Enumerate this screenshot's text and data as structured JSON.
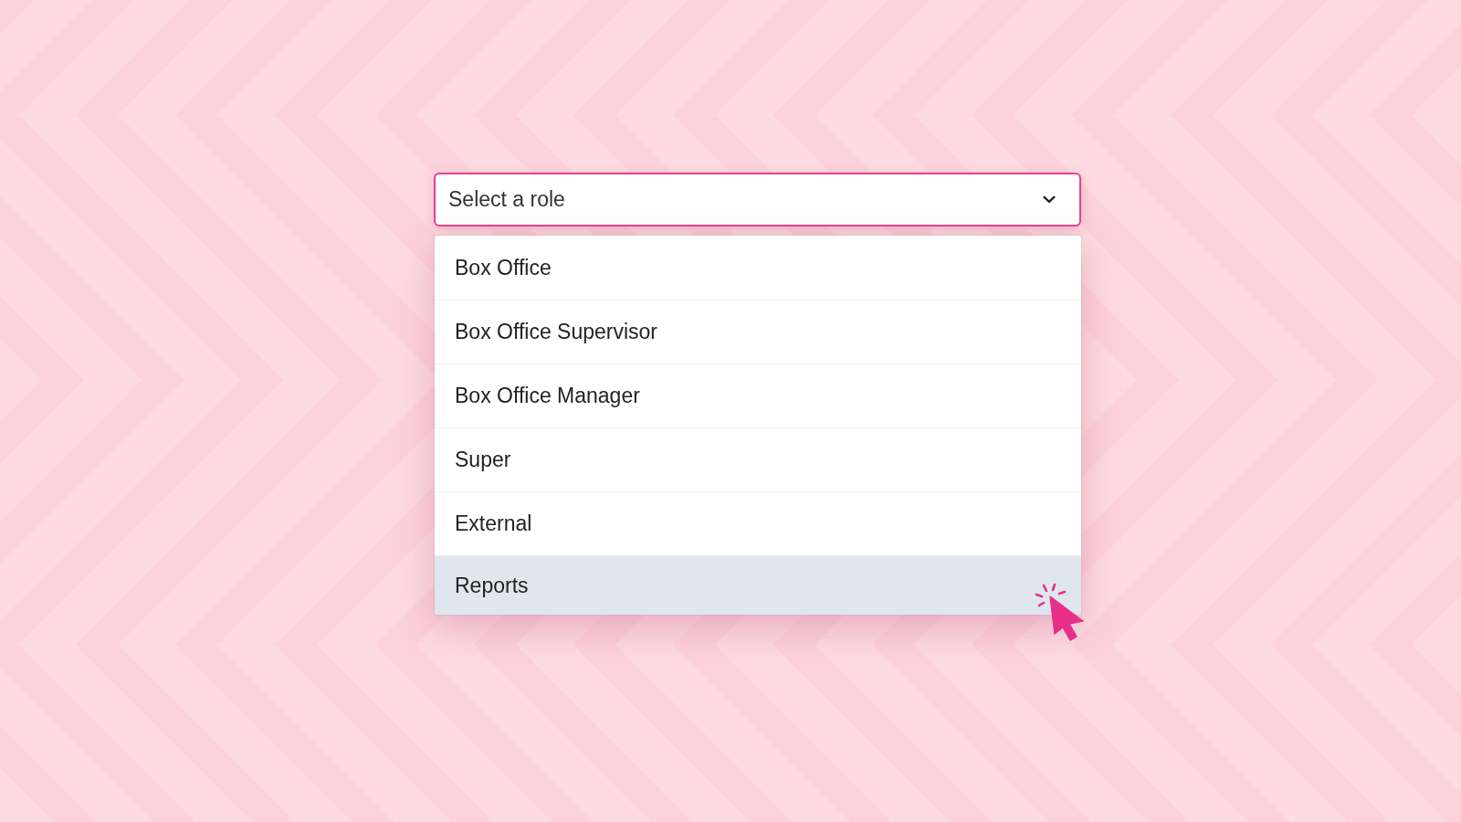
{
  "select": {
    "placeholder": "Select a role",
    "expanded": true
  },
  "options": [
    {
      "label": "Box Office",
      "selected": false
    },
    {
      "label": "Box Office Supervisor",
      "selected": false
    },
    {
      "label": "Box Office Manager",
      "selected": false
    },
    {
      "label": "Super",
      "selected": false
    },
    {
      "label": "External",
      "selected": false
    },
    {
      "label": "Reports",
      "selected": true
    }
  ]
}
